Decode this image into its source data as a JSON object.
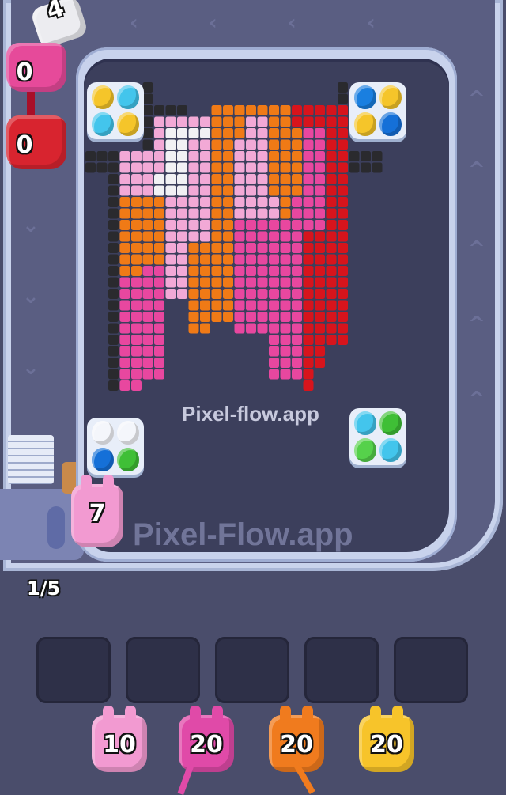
{
  "watermarks": {
    "center": "Pixel-flow.app",
    "track": "Pixel-Flow.app"
  },
  "queue": {
    "counter": "1/5",
    "active_shooter_count": "7"
  },
  "track_shooters": [
    {
      "count": "4",
      "color": "#e8e8ea"
    },
    {
      "count": "0",
      "color": "#e64a9a"
    },
    {
      "count": "0",
      "color": "#d8242f"
    }
  ],
  "bottom_shooters": [
    {
      "count": "10",
      "color": "#f29ad1"
    },
    {
      "count": "20",
      "color": "#e04aa8"
    },
    {
      "count": "20",
      "color": "#f07b1e"
    },
    {
      "count": "20",
      "color": "#f7c42a"
    }
  ],
  "slots": [
    "empty",
    "empty",
    "empty",
    "empty",
    "empty"
  ],
  "baskets": [
    {
      "name": "top-left",
      "eggs": [
        "yellow-cracked",
        "cyan",
        "cyan",
        "yellow-cracked"
      ]
    },
    {
      "name": "top-right",
      "eggs": [
        "blue",
        "yellow-cracked",
        "yellow-cracked",
        "blue-cracked"
      ]
    },
    {
      "name": "bottom-left",
      "eggs": [
        "white-empty",
        "white-empty",
        "blue-cracked",
        "green-cracked"
      ]
    },
    {
      "name": "bottom-right",
      "eggs": [
        "cyan",
        "green-cracked",
        "green",
        "cyan"
      ]
    }
  ],
  "colors": {
    "pink": "#f2a9d6",
    "hot_pink": "#e8479f",
    "orange": "#f07a16",
    "red": "#d7141c",
    "white": "#f1f1f4",
    "black": "#2a2a2e"
  },
  "icons": [
    "chevron-left-icon",
    "chevron-up-icon",
    "chevron-down-icon"
  ]
}
